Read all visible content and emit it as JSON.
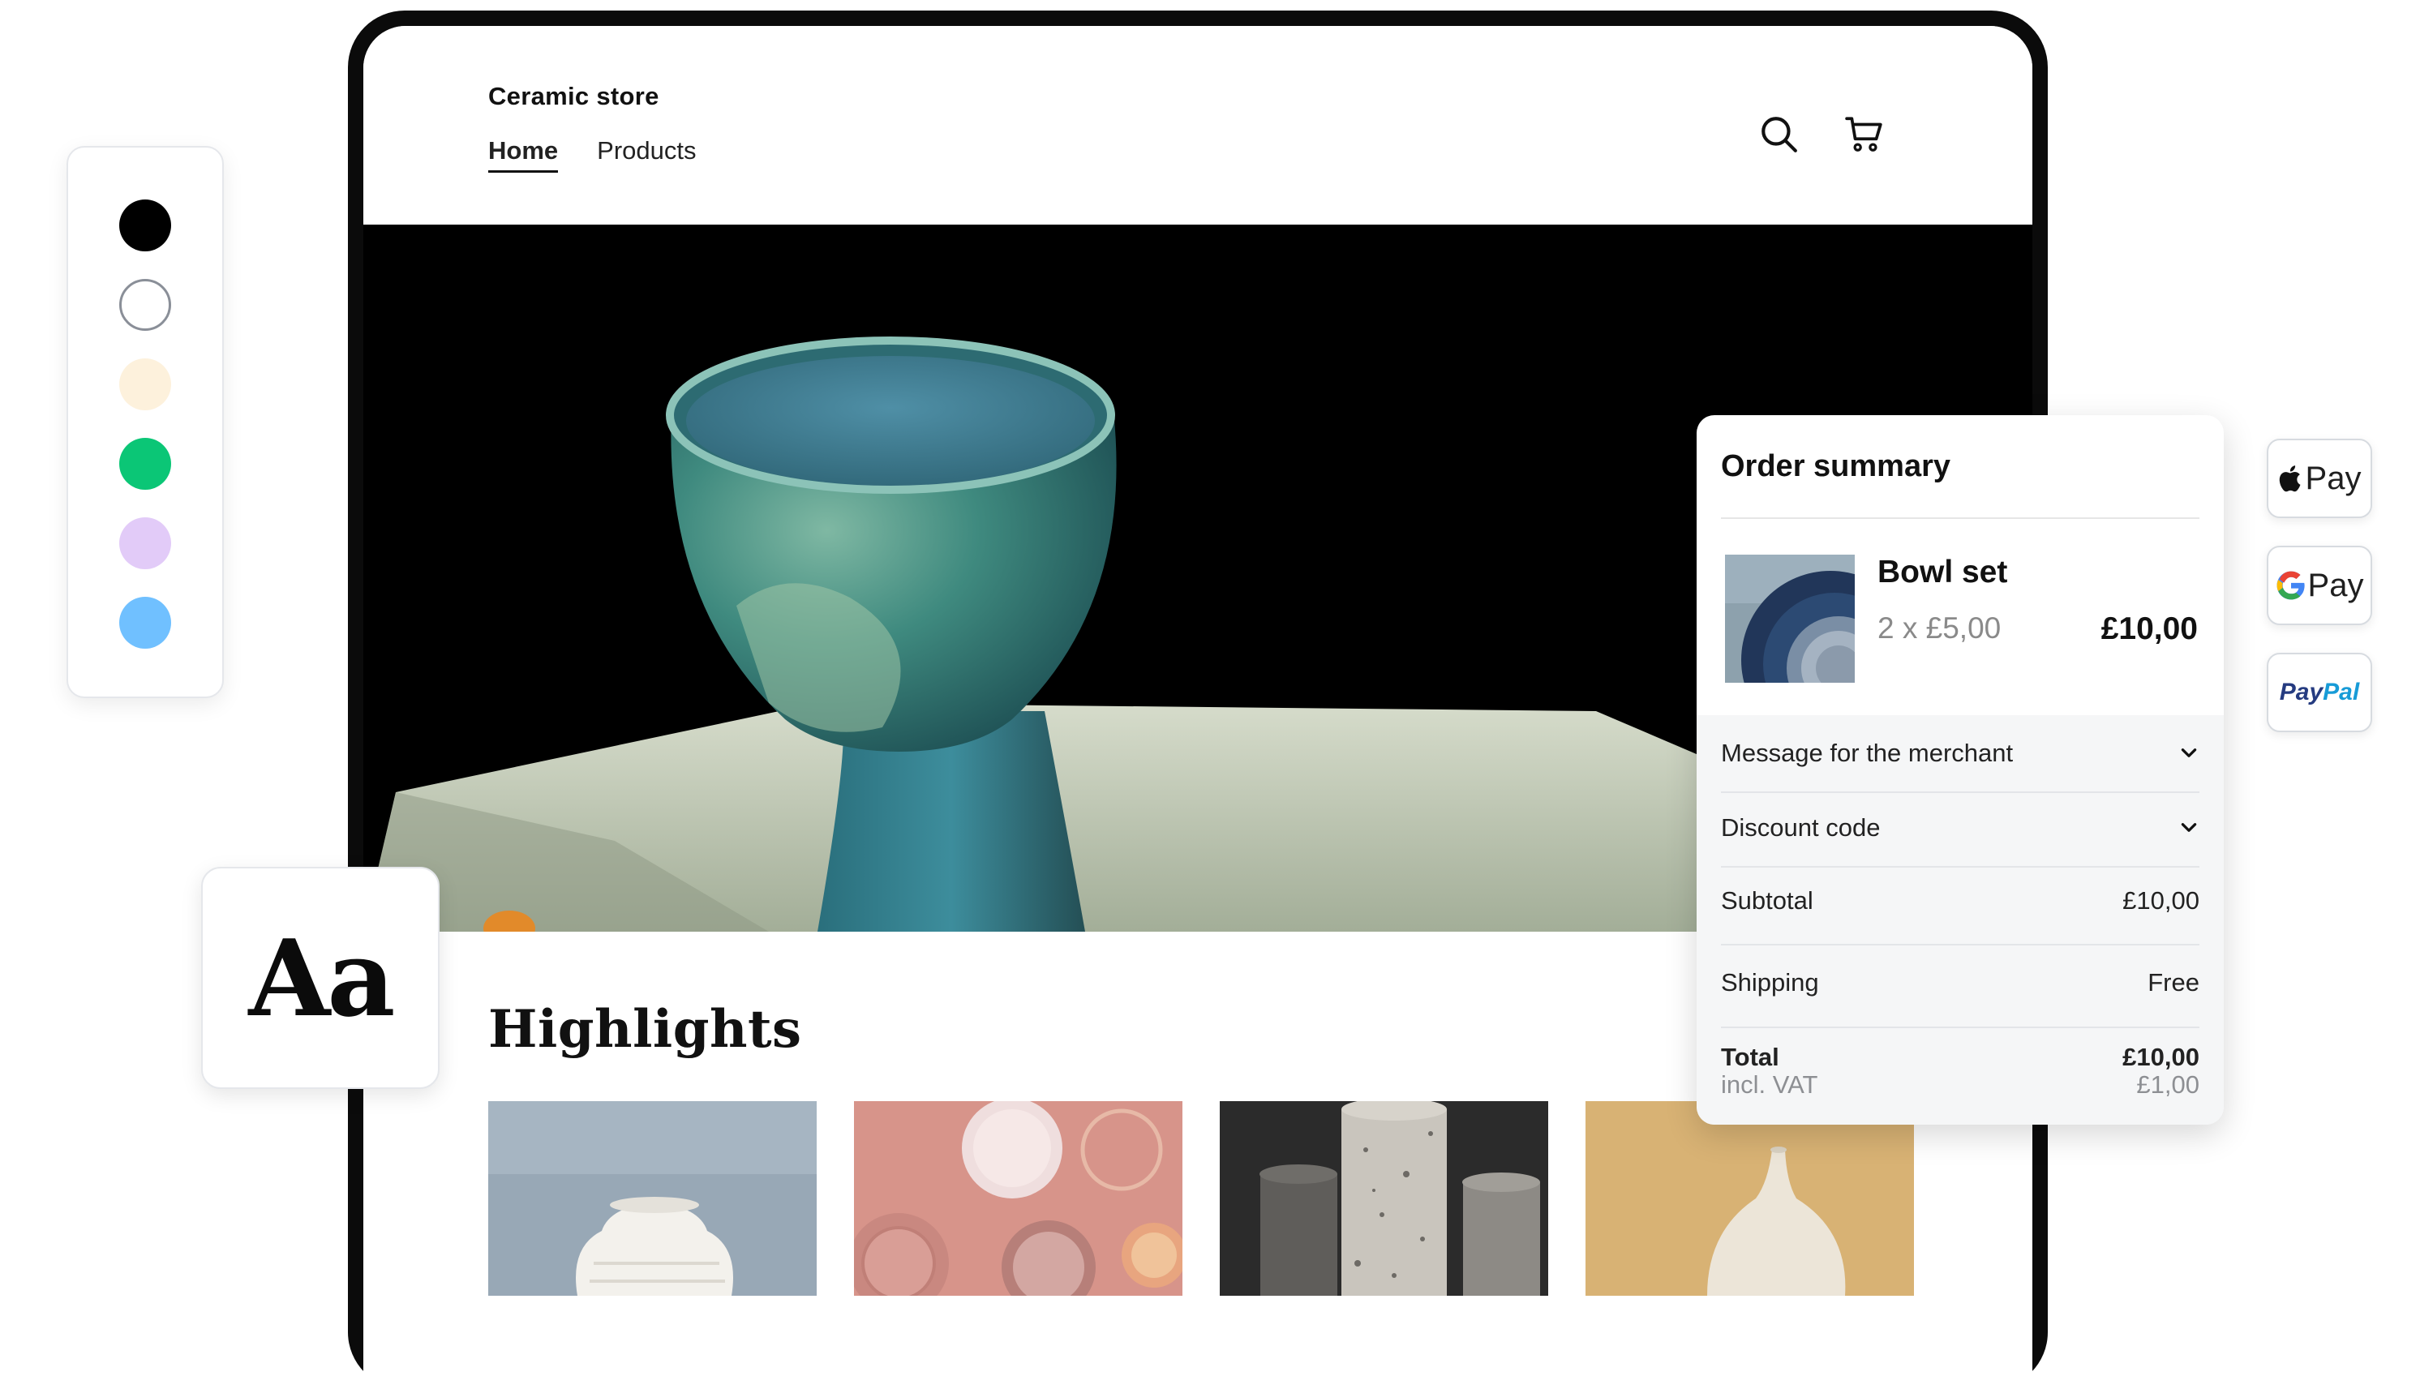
{
  "store": {
    "name": "Ceramic store",
    "nav": [
      {
        "label": "Home",
        "active": true
      },
      {
        "label": "Products",
        "active": false
      }
    ],
    "icons": [
      "search-icon",
      "cart-icon"
    ]
  },
  "highlights": {
    "title": "Highlights"
  },
  "palette": {
    "colors": [
      "#000000",
      "#ffffff",
      "#fdf1dc",
      "#0bc676",
      "#e2cbf8",
      "#70c0ff"
    ]
  },
  "typography": {
    "sample": "Aa"
  },
  "order_summary": {
    "title": "Order summary",
    "item": {
      "name": "Bowl set",
      "quantity_line": "2 x £5,00",
      "line_total": "£10,00"
    },
    "accordions": [
      {
        "label": "Message for the merchant"
      },
      {
        "label": "Discount code"
      }
    ],
    "subtotal": {
      "label": "Subtotal",
      "value": "£10,00"
    },
    "shipping": {
      "label": "Shipping",
      "value": "Free"
    },
    "total": {
      "label": "Total",
      "value": "£10,00",
      "vat_label": "incl. VAT",
      "vat_value": "£1,00"
    }
  },
  "payments": [
    {
      "name": "apple-pay",
      "label": "Pay"
    },
    {
      "name": "google-pay",
      "label": "Pay"
    },
    {
      "name": "paypal",
      "label_part1": "Pay",
      "label_part2": "Pal"
    }
  ]
}
